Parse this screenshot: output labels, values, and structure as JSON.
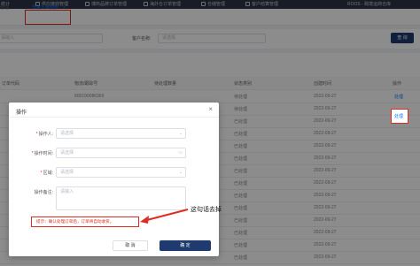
{
  "topnav": {
    "items": [
      {
        "label": "统计"
      },
      {
        "label": "供应链商管理"
      },
      {
        "label": "博商品牌订单管理"
      },
      {
        "label": "海外仓订单管理"
      },
      {
        "label": "仓储管理"
      },
      {
        "label": "客户结算管理"
      }
    ],
    "user": "ROOS - 跨境运商仓库"
  },
  "tabs": [
    {
      "label": "管理"
    },
    {
      "label": "异常入库列表",
      "active": true,
      "close": "×"
    }
  ],
  "filter": {
    "first_placeholder": "请输入",
    "customer_label": "客户名称:",
    "customer_placeholder": "请选择",
    "search_label": "查 询"
  },
  "table": {
    "columns": [
      "订单代码",
      "物流/跟踪号",
      "待处理数量",
      "状态类别",
      "创建时间",
      "操作"
    ],
    "rows": [
      {
        "tracking": "800190086369",
        "status": "待处理",
        "date": "2022-09-27",
        "action": "处理"
      },
      {
        "tracking": "",
        "status": "待处理",
        "date": "2022-09-27",
        "action": "处理"
      },
      {
        "tracking": "",
        "status": "已处理",
        "date": "2022-09-27",
        "action": ""
      },
      {
        "tracking": "",
        "status": "已处理",
        "date": "2022-09-27",
        "action": ""
      },
      {
        "tracking": "",
        "status": "已处理",
        "date": "2022-09-27",
        "action": ""
      },
      {
        "tracking": "",
        "status": "已处理",
        "date": "2022-09-27",
        "action": ""
      },
      {
        "tracking": "",
        "status": "已处理",
        "date": "2022-09-27",
        "action": ""
      },
      {
        "tracking": "",
        "status": "已处理",
        "date": "2022-09-27",
        "action": ""
      },
      {
        "tracking": "",
        "status": "已处理",
        "date": "2022-09-27",
        "action": ""
      },
      {
        "tracking": "",
        "status": "已处理",
        "date": "2022-09-27",
        "action": ""
      },
      {
        "tracking": "",
        "status": "已处理",
        "date": "2022-09-27",
        "action": ""
      },
      {
        "tracking": "",
        "status": "已处理",
        "date": "2022-09-27",
        "action": ""
      },
      {
        "tracking": "",
        "status": "已处理",
        "date": "2022-09-27",
        "action": ""
      },
      {
        "tracking": "",
        "status": "已处理",
        "date": "2022-09-27",
        "action": ""
      }
    ]
  },
  "dialog": {
    "title": "操作",
    "close": "×",
    "operator_label": "操作人:",
    "operator_placeholder": "请选择",
    "optime_label": "操作时间:",
    "optime_placeholder": "请选择",
    "area_label": "区域:",
    "area_placeholder": "请选择",
    "remark_label": "操作备注:",
    "remark_placeholder": "请输入",
    "tip": "提示：确认处理订单后，订单将自动收货。",
    "cancel_label": "取 消",
    "ok_label": "确 定"
  },
  "annotation": "这句话去掉",
  "colors": {
    "accent": "#1677ff",
    "primary": "#1e3a6e",
    "highlight": "#e02b20"
  }
}
